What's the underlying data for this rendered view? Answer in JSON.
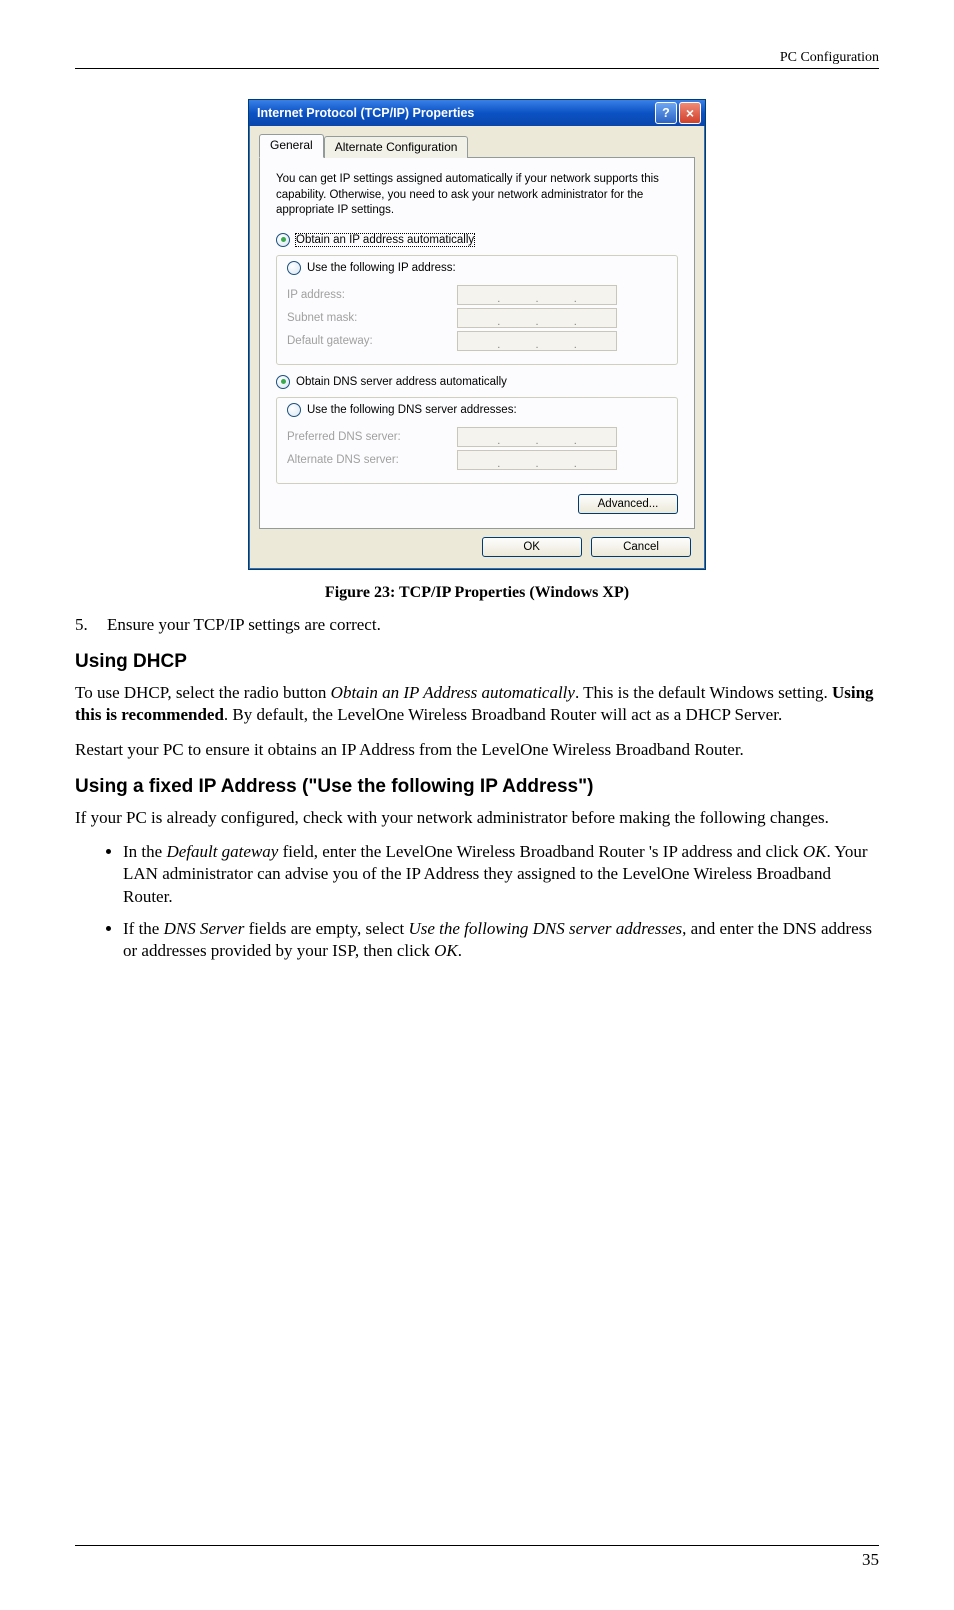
{
  "header": {
    "label": "PC Configuration"
  },
  "footer": {
    "page": "35"
  },
  "dialog": {
    "title": "Internet Protocol (TCP/IP) Properties",
    "tabs": {
      "general": "General",
      "alt": "Alternate Configuration"
    },
    "description": "You can get IP settings assigned automatically if your network supports this capability. Otherwise, you need to ask your network administrator for the appropriate IP settings.",
    "radios": {
      "obtain_ip": "Obtain an IP address automatically",
      "use_ip": "Use the following IP address:",
      "obtain_dns": "Obtain DNS server address automatically",
      "use_dns": "Use the following DNS server addresses:"
    },
    "fields": {
      "ip_address": "IP address:",
      "subnet": "Subnet mask:",
      "gateway": "Default gateway:",
      "pref_dns": "Preferred DNS server:",
      "alt_dns": "Alternate DNS server:"
    },
    "buttons": {
      "advanced": "Advanced...",
      "ok": "OK",
      "cancel": "Cancel"
    }
  },
  "caption": "Figure 23: TCP/IP Properties (Windows XP)",
  "doc": {
    "step5_num": "5.",
    "step5": "Ensure your TCP/IP settings are correct.",
    "h_dhcp": "Using DHCP",
    "p_dhcp1_a": "To use DHCP, select the radio button ",
    "p_dhcp1_i": "Obtain an IP Address automatically",
    "p_dhcp1_b": ". This is the default Windows setting. ",
    "p_dhcp1_bold": "Using this is recommended",
    "p_dhcp1_c": ". By default, the LevelOne Wireless Broadband Router will act as a DHCP Server.",
    "p_dhcp2": "Restart your PC to ensure it obtains an IP Address from the LevelOne Wireless Broadband Router.",
    "h_fixed": "Using a fixed IP Address (\"Use the following IP Address\")",
    "p_fixed1": "If your PC is already configured, check with your network administrator before making the following changes.",
    "b1_a": "In the ",
    "b1_i1": "Default gateway",
    "b1_b": " field, enter the LevelOne Wireless Broadband Router 's IP address and click ",
    "b1_i2": "OK",
    "b1_c": ". Your LAN administrator can advise you of the IP Address they assigned to the LevelOne Wireless Broadband Router.",
    "b2_a": "If the ",
    "b2_i1": "DNS Server",
    "b2_b": " fields are empty, select ",
    "b2_i2": "Use the following DNS server addresses",
    "b2_c": ", and enter the DNS address or addresses provided by your ISP, then click ",
    "b2_i3": "OK",
    "b2_d": "."
  }
}
